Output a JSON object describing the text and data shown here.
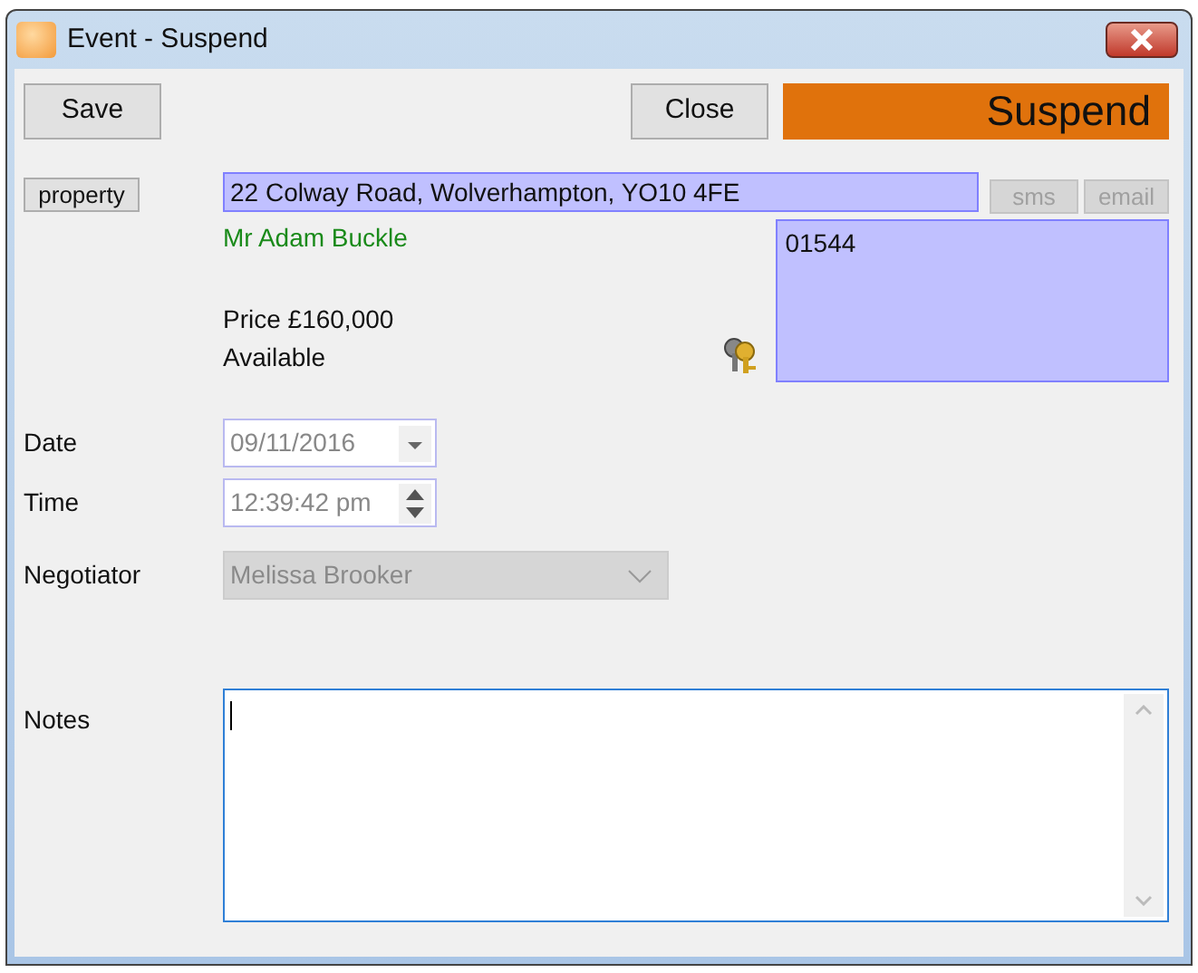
{
  "window": {
    "title": "Event - Suspend"
  },
  "toolbar": {
    "buttons": [
      {
        "label": "Save"
      },
      {
        "label": "Close"
      }
    ],
    "status_banner": "Suspend"
  },
  "property": {
    "button": "property",
    "address": "22 Colway Road, Wolverhampton, YO10 4FE",
    "contact_buttons": [
      {
        "label": "sms",
        "disabled": true
      },
      {
        "label": "email",
        "disabled": true
      }
    ],
    "contact_name": "Mr Adam Buckle",
    "phone": "01544",
    "price": "Price £160,000",
    "availability": "Available"
  },
  "fields": [
    {
      "kind": "date",
      "label": "Date",
      "value": "09/11/2016"
    },
    {
      "kind": "time",
      "label": "Time",
      "value": "12:39:42 pm"
    },
    {
      "kind": "select",
      "label": "Negotiator",
      "value": "Melissa Brooker",
      "disabled": true
    }
  ],
  "notes": {
    "label": "Notes",
    "focused": true
  }
}
